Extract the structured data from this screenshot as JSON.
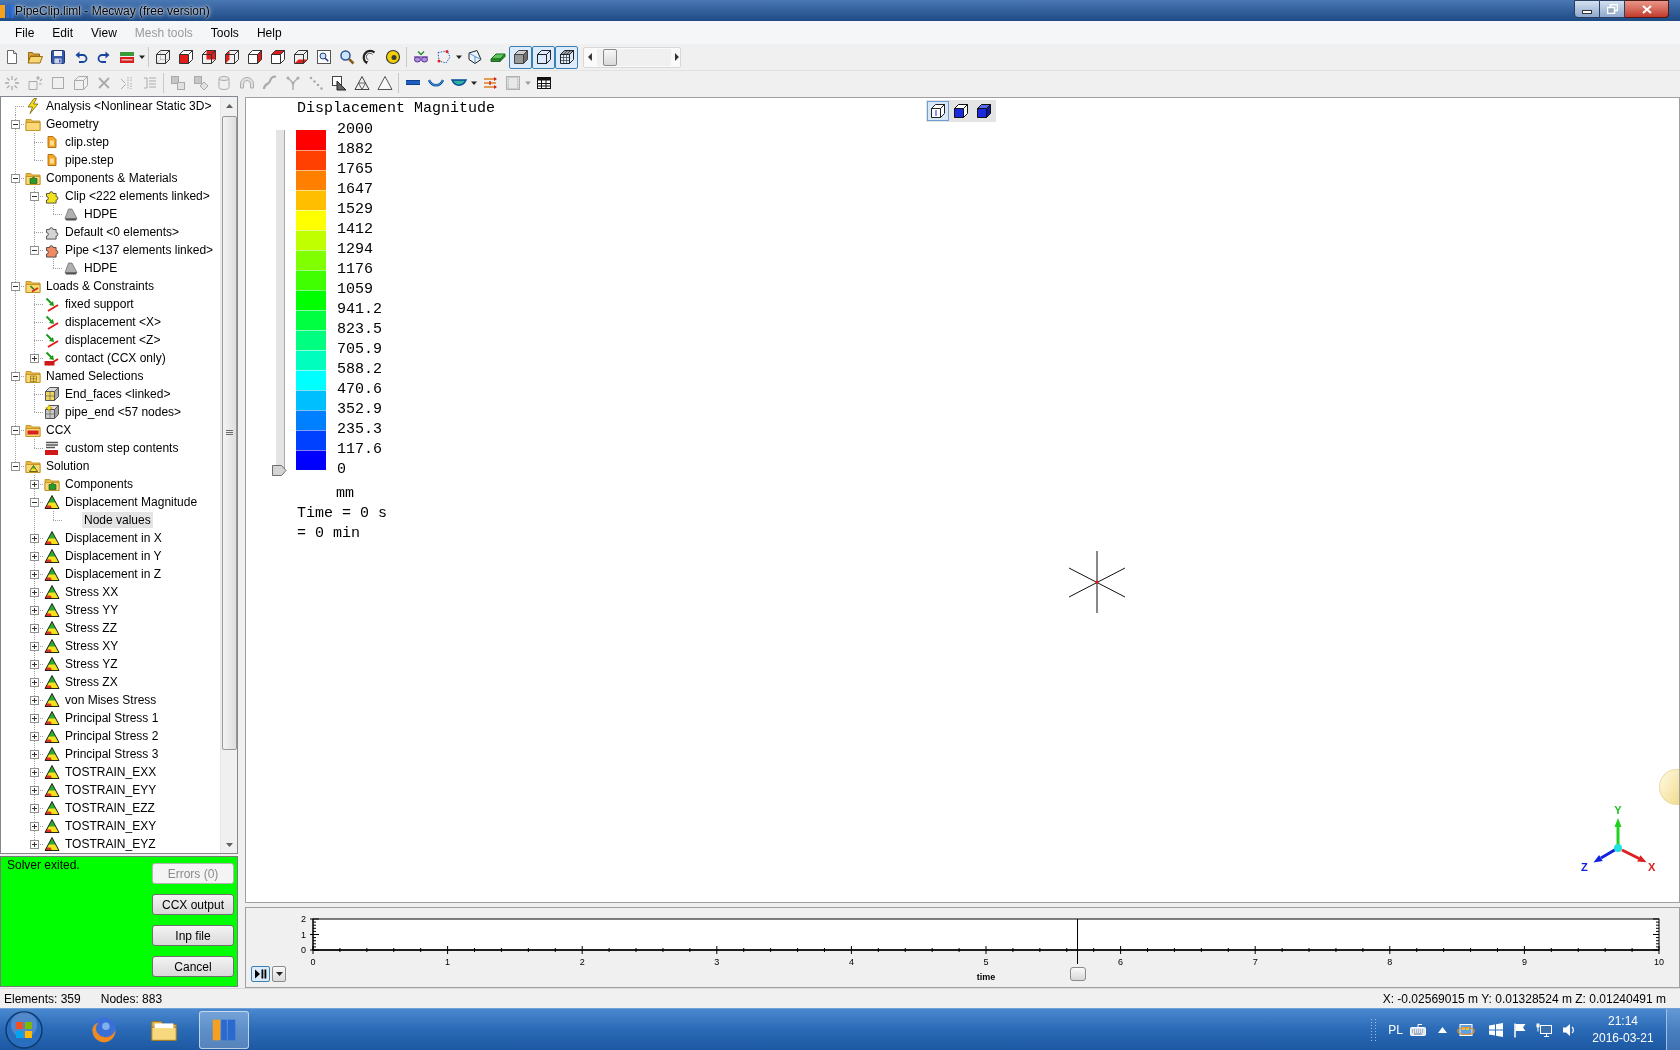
{
  "window": {
    "title": "PipeClip.liml - Mecway (free version)"
  },
  "menu": [
    {
      "label": "File",
      "disabled": false
    },
    {
      "label": "Edit",
      "disabled": false
    },
    {
      "label": "View",
      "disabled": false
    },
    {
      "label": "Mesh tools",
      "disabled": true
    },
    {
      "label": "Tools",
      "disabled": false
    },
    {
      "label": "Help",
      "disabled": false
    }
  ],
  "toolbar_1": {
    "items": [
      {
        "kind": "new",
        "pressed": false,
        "disabled": false
      },
      {
        "kind": "open",
        "pressed": false,
        "disabled": false
      },
      {
        "kind": "save",
        "pressed": false,
        "disabled": false
      },
      {
        "kind": "undo",
        "pressed": false,
        "disabled": false
      },
      {
        "kind": "redo",
        "pressed": false,
        "disabled": false
      },
      {
        "kind": "solve",
        "pressed": false,
        "disabled": false
      },
      {
        "kind": "caret",
        "disabled": false
      },
      {
        "kind": "separator"
      },
      {
        "kind": "cube-wire",
        "pressed": false,
        "disabled": false
      },
      {
        "kind": "cube-front",
        "pressed": false,
        "disabled": false
      },
      {
        "kind": "cube-back",
        "pressed": false,
        "disabled": false
      },
      {
        "kind": "cube-left",
        "pressed": false,
        "disabled": false
      },
      {
        "kind": "cube-right",
        "pressed": false,
        "disabled": false
      },
      {
        "kind": "cube-top",
        "pressed": false,
        "disabled": false
      },
      {
        "kind": "cube-bottom",
        "pressed": false,
        "disabled": false
      },
      {
        "kind": "zoom-box",
        "pressed": false,
        "disabled": false
      },
      {
        "kind": "zoom",
        "pressed": false,
        "disabled": false
      },
      {
        "kind": "rotate",
        "pressed": false,
        "disabled": false
      },
      {
        "kind": "pan",
        "pressed": false,
        "disabled": false
      },
      {
        "kind": "separator"
      },
      {
        "kind": "visibility",
        "pressed": false,
        "disabled": false
      },
      {
        "kind": "select",
        "pressed": false,
        "disabled": false
      },
      {
        "kind": "caret",
        "disabled": false
      },
      {
        "kind": "polygon",
        "pressed": false,
        "disabled": false
      },
      {
        "kind": "plate",
        "pressed": false,
        "disabled": false
      },
      {
        "kind": "shaded",
        "pressed": true,
        "disabled": false
      },
      {
        "kind": "wireframe",
        "pressed": true,
        "disabled": false
      },
      {
        "kind": "mesh",
        "pressed": true,
        "disabled": false
      }
    ],
    "slider": {
      "level": 0.1
    }
  },
  "toolbar_2": {
    "items": [
      {
        "kind": "burst",
        "pressed": false,
        "disabled": true
      },
      {
        "kind": "node-frame",
        "pressed": false,
        "disabled": true
      },
      {
        "kind": "square",
        "pressed": false,
        "disabled": true
      },
      {
        "kind": "cube-outline",
        "pressed": false,
        "disabled": true
      },
      {
        "kind": "cross",
        "pressed": false,
        "disabled": true
      },
      {
        "kind": "split",
        "pressed": false,
        "disabled": true
      },
      {
        "kind": "list",
        "pressed": false,
        "disabled": true
      },
      {
        "kind": "separator"
      },
      {
        "kind": "squares",
        "pressed": false,
        "disabled": true
      },
      {
        "kind": "square-diamond",
        "pressed": false,
        "disabled": true
      },
      {
        "kind": "cylinder",
        "pressed": false,
        "disabled": true
      },
      {
        "kind": "arch",
        "pressed": false,
        "disabled": true
      },
      {
        "kind": "s-curve",
        "pressed": false,
        "disabled": true
      },
      {
        "kind": "fork",
        "pressed": false,
        "disabled": true
      },
      {
        "kind": "dots",
        "pressed": false,
        "disabled": true
      },
      {
        "kind": "tri-box",
        "pressed": false,
        "disabled": false
      },
      {
        "kind": "tri-mesh",
        "pressed": false,
        "disabled": false
      },
      {
        "kind": "triangle",
        "pressed": false,
        "disabled": false
      },
      {
        "kind": "separator"
      },
      {
        "kind": "beam",
        "pressed": false,
        "disabled": false
      },
      {
        "kind": "shell",
        "pressed": false,
        "disabled": false
      },
      {
        "kind": "shell-fill",
        "pressed": false,
        "disabled": false
      },
      {
        "kind": "caret",
        "disabled": false
      },
      {
        "kind": "loads",
        "pressed": false,
        "disabled": false
      },
      {
        "kind": "film",
        "pressed": false,
        "disabled": true
      },
      {
        "kind": "caret",
        "disabled": true
      },
      {
        "kind": "table",
        "pressed": false,
        "disabled": false
      }
    ]
  },
  "tree": {
    "items": [
      {
        "label": "Analysis <Nonlinear Static 3D>",
        "kind": "analysis",
        "selected": false
      },
      {
        "label": "Geometry",
        "kind": "folder",
        "selected": false,
        "expanded": true,
        "children": [
          {
            "label": "clip.step",
            "kind": "geometry",
            "selected": false
          },
          {
            "label": "pipe.step",
            "kind": "geometry",
            "selected": false
          }
        ]
      },
      {
        "label": "Components & Materials",
        "kind": "folder-components",
        "selected": false,
        "expanded": true,
        "children": [
          {
            "label": "Clip <222 elements linked>",
            "kind": "component",
            "color": "#f2e21c",
            "selected": false,
            "expanded": true,
            "children": [
              {
                "label": "HDPE",
                "kind": "material",
                "selected": false
              }
            ]
          },
          {
            "label": "Default <0 elements>",
            "kind": "component",
            "color": "#d4d4d4",
            "selected": false
          },
          {
            "label": "Pipe <137 elements linked>",
            "kind": "component",
            "color": "#f08a62",
            "selected": false,
            "expanded": true,
            "children": [
              {
                "label": "HDPE",
                "kind": "material",
                "selected": false
              }
            ]
          }
        ]
      },
      {
        "label": "Loads & Constraints",
        "kind": "folder-loads",
        "selected": false,
        "expanded": true,
        "children": [
          {
            "label": "fixed support",
            "kind": "load",
            "selected": false
          },
          {
            "label": "displacement <X>",
            "kind": "load",
            "selected": false
          },
          {
            "label": "displacement <Z>",
            "kind": "load",
            "selected": false
          },
          {
            "label": "contact (CCX only)",
            "kind": "contact",
            "selected": false,
            "expanded": false
          }
        ]
      },
      {
        "label": "Named Selections",
        "kind": "folder-selections",
        "selected": false,
        "expanded": true,
        "children": [
          {
            "label": "End_faces <linked>",
            "kind": "selection",
            "selected": false
          },
          {
            "label": "pipe_end <57 nodes>",
            "kind": "selection-nodes",
            "selected": false
          }
        ]
      },
      {
        "label": "CCX",
        "kind": "folder-ccx",
        "selected": false,
        "expanded": true,
        "children": [
          {
            "label": "custom step contents",
            "kind": "custom-step",
            "selected": false
          }
        ]
      },
      {
        "label": "Solution",
        "kind": "folder-solution",
        "selected": false,
        "expanded": true,
        "children": [
          {
            "label": "Components",
            "kind": "folder-components",
            "selected": false,
            "expanded": false
          },
          {
            "label": "Displacement Magnitude",
            "kind": "result",
            "selected": false,
            "expanded": true,
            "children": [
              {
                "label": "Node values",
                "kind": "data",
                "selected": true
              }
            ]
          },
          {
            "label": "Displacement in X",
            "kind": "result",
            "selected": false,
            "expanded": false
          },
          {
            "label": "Displacement in Y",
            "kind": "result",
            "selected": false,
            "expanded": false
          },
          {
            "label": "Displacement in Z",
            "kind": "result",
            "selected": false,
            "expanded": false
          },
          {
            "label": "Stress XX",
            "kind": "result",
            "selected": false,
            "expanded": false
          },
          {
            "label": "Stress YY",
            "kind": "result",
            "selected": false,
            "expanded": false
          },
          {
            "label": "Stress ZZ",
            "kind": "result",
            "selected": false,
            "expanded": false
          },
          {
            "label": "Stress XY",
            "kind": "result",
            "selected": false,
            "expanded": false
          },
          {
            "label": "Stress YZ",
            "kind": "result",
            "selected": false,
            "expanded": false
          },
          {
            "label": "Stress ZX",
            "kind": "result",
            "selected": false,
            "expanded": false
          },
          {
            "label": "von Mises Stress",
            "kind": "result",
            "selected": false,
            "expanded": false
          },
          {
            "label": "Principal Stress 1",
            "kind": "result",
            "selected": false,
            "expanded": false
          },
          {
            "label": "Principal Stress 2",
            "kind": "result",
            "selected": false,
            "expanded": false
          },
          {
            "label": "Principal Stress 3",
            "kind": "result",
            "selected": false,
            "expanded": false
          },
          {
            "label": "TOSTRAIN_EXX",
            "kind": "result",
            "selected": false,
            "expanded": false
          },
          {
            "label": "TOSTRAIN_EYY",
            "kind": "result",
            "selected": false,
            "expanded": false
          },
          {
            "label": "TOSTRAIN_EZZ",
            "kind": "result",
            "selected": false,
            "expanded": false
          },
          {
            "label": "TOSTRAIN_EXY",
            "kind": "result",
            "selected": false,
            "expanded": false
          },
          {
            "label": "TOSTRAIN_EYZ",
            "kind": "result",
            "selected": false,
            "expanded": false
          }
        ]
      }
    ]
  },
  "solver": {
    "message": "Solver exited.",
    "buttons": [
      {
        "label": "Errors (0)",
        "disabled": true
      },
      {
        "label": "CCX output",
        "disabled": false
      },
      {
        "label": "Inp file",
        "disabled": false
      },
      {
        "label": "Cancel",
        "disabled": false
      }
    ]
  },
  "viewport": {
    "legend": {
      "title": "Displacement Magnitude",
      "labels": [
        "2000",
        "1882",
        "1765",
        "1647",
        "1529",
        "1412",
        "1294",
        "1176",
        "1059",
        "941.2",
        "823.5",
        "705.9",
        "588.2",
        "470.6",
        "352.9",
        "235.3",
        "117.6",
        "0"
      ],
      "unit": "mm",
      "threshold_slider": {
        "level": 0
      }
    },
    "time_readout": [
      "Time = 0 s",
      "= 0 min"
    ],
    "view_modes": [
      {
        "kind": "outline",
        "selected": true
      },
      {
        "kind": "half",
        "selected": false
      },
      {
        "kind": "solid",
        "selected": false
      }
    ],
    "axis_triad": {
      "y_label": "Y",
      "z_label": "Z",
      "x_label": "X"
    }
  },
  "timeline": {
    "chart_data": {
      "type": "line",
      "xlabel": "time",
      "xlim": [
        0,
        10
      ],
      "ylim": [
        0,
        2
      ],
      "xticks": [
        0,
        1,
        2,
        3,
        4,
        5,
        6,
        7,
        8,
        9,
        10
      ],
      "yticks": [
        0,
        1,
        2
      ],
      "ref_lines": [
        {
          "axis": "x",
          "value": 5.68
        }
      ]
    },
    "time_slider": {
      "level": 0.568
    }
  },
  "status_bar": {
    "elements": "Elements: 359",
    "nodes": "Nodes: 883",
    "coordinates": "X: -0.02569015 m Y: 0.01328524 m Z: 0.01240491 m"
  },
  "taskbar": {
    "apps": [
      {
        "kind": "browser",
        "active": false
      },
      {
        "kind": "file-manager",
        "active": false
      },
      {
        "kind": "modeler",
        "active": true
      }
    ],
    "tray": {
      "language": "PL",
      "time": "21:14",
      "date": "2016-03-21"
    }
  }
}
